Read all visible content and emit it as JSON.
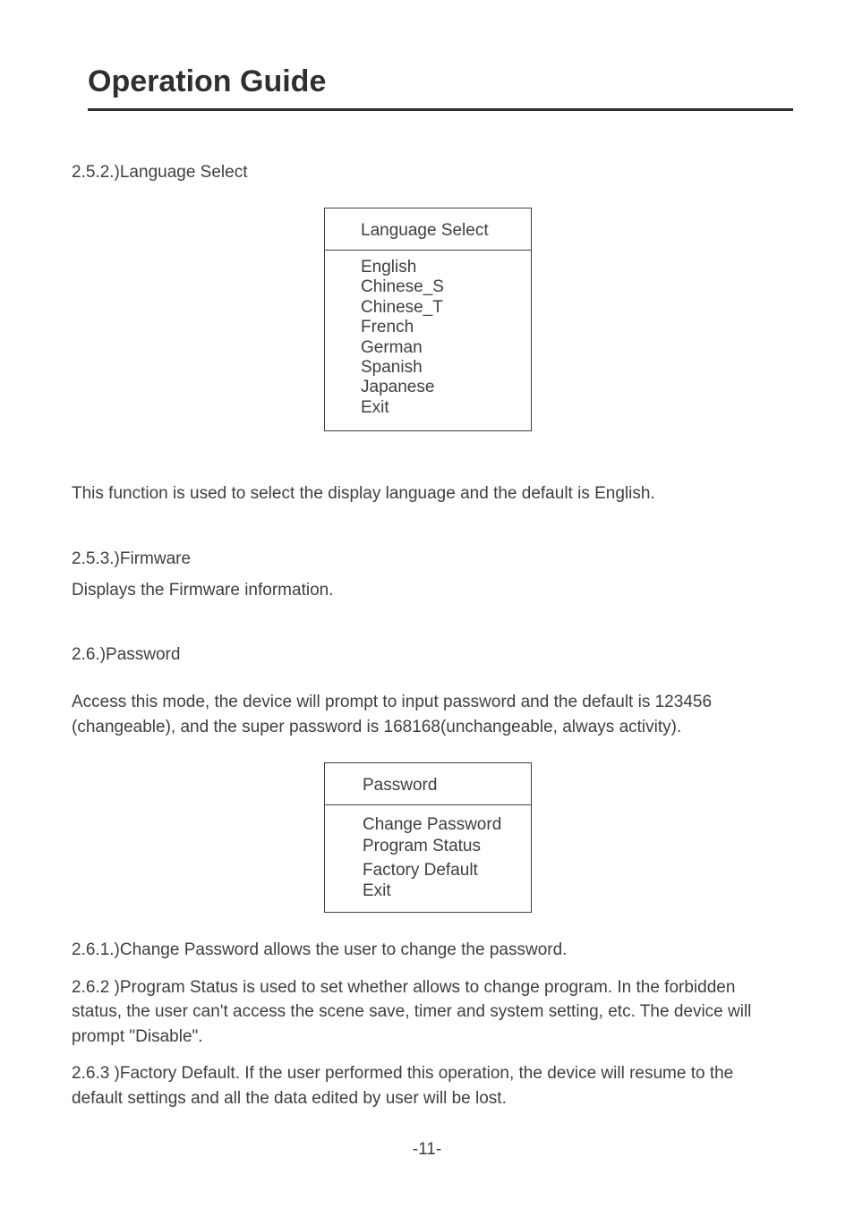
{
  "page": {
    "title": "Operation Guide",
    "number": "-11-"
  },
  "sections": {
    "s252": {
      "heading": "2.5.2.)Language Select",
      "desc": "This function is used to select the display language and the default is English."
    },
    "s253": {
      "heading": "2.5.3.)Firmware",
      "desc": "Displays the Firmware information."
    },
    "s26": {
      "heading": "2.6.)Password",
      "desc": "Access this mode, the device will prompt to input password and the default is 123456 (changeable), and the super password is 168168(unchangeable, always activity)."
    },
    "s261": "2.6.1.)Change Password allows the user to change the password.",
    "s262": "2.6.2 )Program Status is used to set whether allows to change program. In the forbidden status, the user can't access the scene save, timer and system setting, etc. The device will prompt \"Disable\".",
    "s263": "2.6.3 )Factory Default. If the user performed this operation, the device will resume to the default settings and all the data edited by user will be lost."
  },
  "languageMenu": {
    "header": "Language Select",
    "items": {
      "i0": "English",
      "i1": "Chinese_S",
      "i2": "Chinese_T",
      "i3": "French",
      "i4": "German",
      "i5": "Spanish",
      "i6": "Japanese",
      "i7": "Exit"
    }
  },
  "passwordMenu": {
    "header": "Password",
    "items": {
      "i0": "Change Password",
      "i1": "Program Status",
      "i2": "Factory Default",
      "i3": "Exit"
    }
  }
}
